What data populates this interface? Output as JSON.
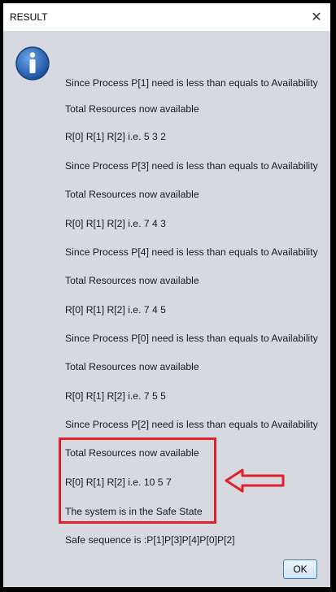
{
  "dialog": {
    "title": "RESULT",
    "lines": [
      "Since Process P[1] need is less than equals to Availability",
      "Total Resources now available",
      "R[0] R[1] R[2] i.e. 5 3 2",
      "Since Process P[3] need is less than equals to Availability",
      "Total Resources now available",
      "R[0] R[1] R[2] i.e. 7 4 3",
      "Since Process P[4] need is less than equals to Availability",
      "Total Resources now available",
      "R[0] R[1] R[2] i.e. 7 4 5",
      "Since Process P[0] need is less than equals to Availability",
      "Total Resources now available",
      "R[0] R[1] R[2] i.e. 7 5 5",
      "Since Process P[2] need is less than equals to Availability",
      "Total Resources now available",
      "R[0] R[1] R[2] i.e. 10 5 7",
      "The system is in the Safe State",
      "Safe sequence is :P[1]P[3]P[4]P[0]P[2]"
    ],
    "ok_label": "OK",
    "icon": "info-icon",
    "close_icon": "close-icon",
    "highlight_color": "#e0202a"
  }
}
